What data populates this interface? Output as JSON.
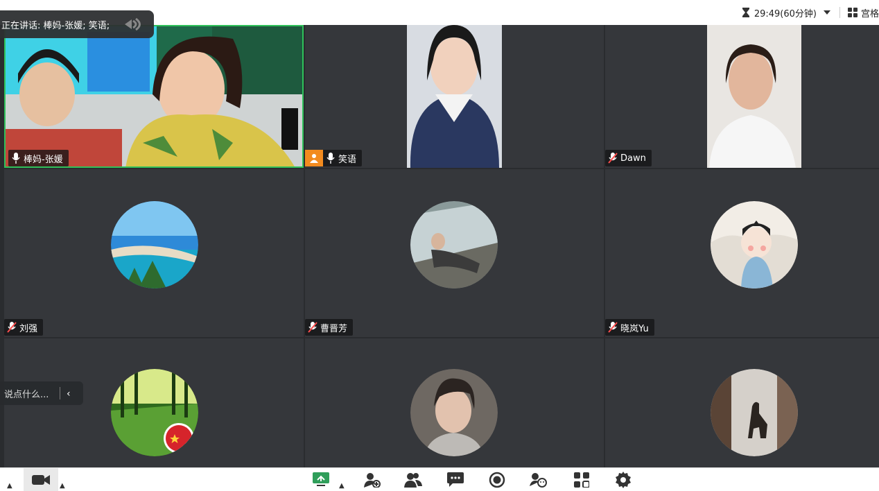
{
  "topbar": {
    "timer_text": "29:49(60分钟)",
    "view_label": "宫格"
  },
  "speaking": {
    "text": "正在讲话:  棒妈-张媛; 笑语;"
  },
  "tiles": [
    {
      "name": "棒妈-张媛",
      "mic": "mic-on",
      "video": true,
      "active": true
    },
    {
      "name": "笑语",
      "mic": "mic-on",
      "video": true,
      "host_badge": true
    },
    {
      "name": "Dawn",
      "mic": "mic-muted",
      "video": true
    },
    {
      "name": "刘强",
      "mic": "mic-muted",
      "video": false
    },
    {
      "name": "曹晋芳",
      "mic": "mic-muted",
      "video": false
    },
    {
      "name": "晓岚Yu",
      "mic": "mic-muted",
      "video": false
    },
    {
      "name": "",
      "video": false
    },
    {
      "name": "",
      "video": false
    },
    {
      "name": "",
      "video": false
    }
  ],
  "chat": {
    "placeholder": "说点什么..."
  },
  "toolbar": {
    "items": [
      "camera",
      "share-screen",
      "invite",
      "participants",
      "chat",
      "record",
      "reactions",
      "apps",
      "settings"
    ]
  },
  "colors": {
    "grid_bg": "#2a2c2f",
    "tile_bg": "#35373b",
    "active_border": "#2fc15a",
    "host_badge": "#f28b1f"
  }
}
